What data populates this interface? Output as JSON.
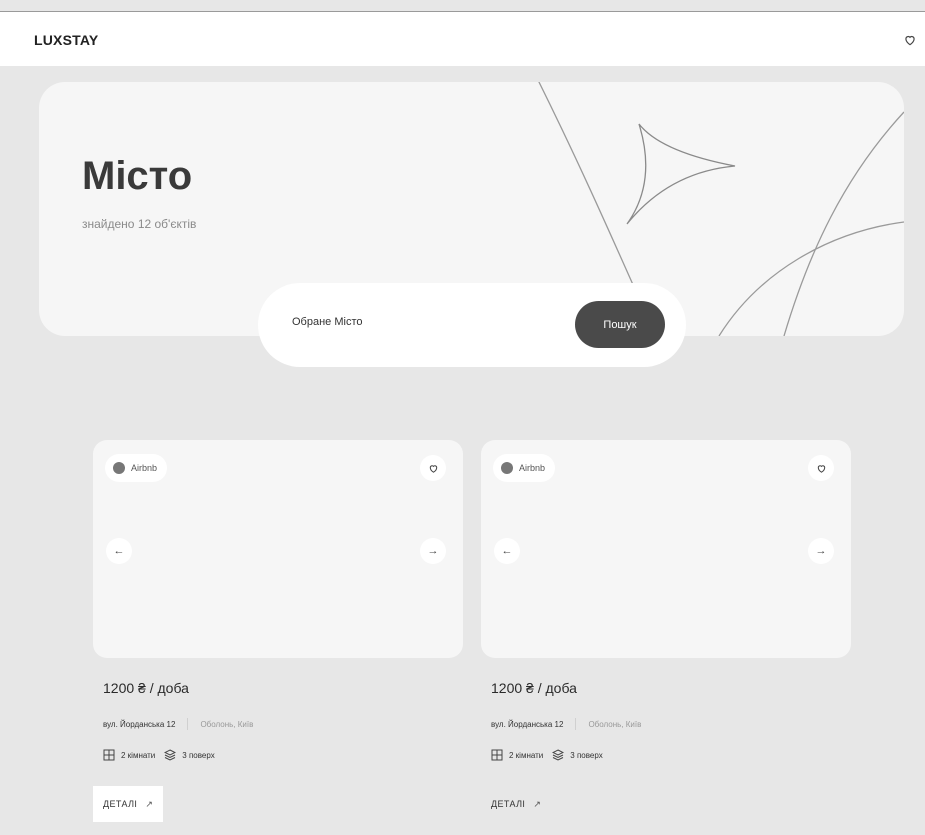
{
  "header": {
    "logo": "LUXSTAY",
    "favorites_icon": "heart-outline-icon"
  },
  "hero": {
    "title": "Місто",
    "subtitle": "знайдено 12 об'єктів"
  },
  "search": {
    "value": "Обране Місто",
    "button_label": "Пошук"
  },
  "listings": [
    {
      "source": "Airbnb",
      "price": "1200 ₴ / доба",
      "street": "вул. Йорданська 12",
      "district": "Оболонь, Київ",
      "rooms": "2 кімнати",
      "floors": "3 поверх",
      "details_label": "ДЕТАЛІ",
      "details_arrow": "↗"
    },
    {
      "source": "Airbnb",
      "price": "1200 ₴ / доба",
      "street": "вул. Йорданська 12",
      "district": "Оболонь, Київ",
      "rooms": "2 кімнати",
      "floors": "3 поверх",
      "details_label": "ДЕТАЛІ",
      "details_arrow": "↗"
    }
  ],
  "controls": {
    "prev_arrow": "←",
    "next_arrow": "→"
  },
  "colors": {
    "page_background": "#e7e7e7",
    "surface": "#f6f6f6",
    "button_dark": "#4a4a4a"
  }
}
